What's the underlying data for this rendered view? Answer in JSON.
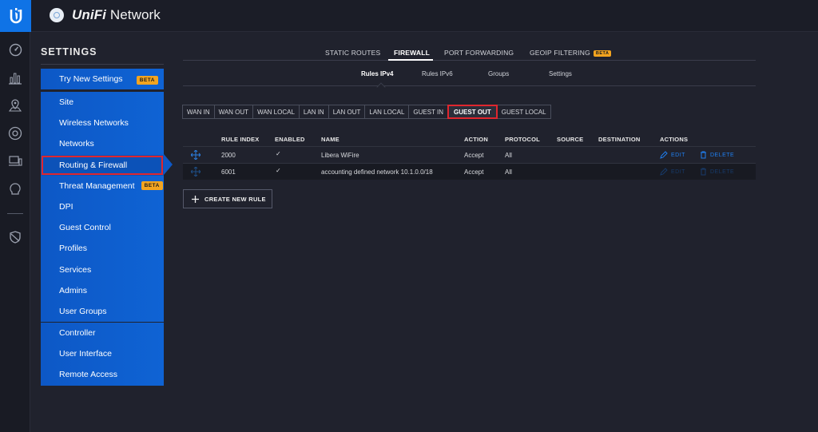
{
  "app": {
    "name_brand": "UniFi",
    "name_suffix": " Network"
  },
  "rail": {
    "icons": [
      "dashboard-icon",
      "statistics-icon",
      "map-icon",
      "devices-icon",
      "clients-icon",
      "insights-icon",
      "shield-icon"
    ]
  },
  "sidebar": {
    "title": "SETTINGS",
    "try_new": {
      "label": "Try New Settings",
      "badge": "BETA"
    },
    "items": [
      {
        "label": "Site"
      },
      {
        "label": "Wireless Networks"
      },
      {
        "label": "Networks"
      },
      {
        "label": "Routing & Firewall"
      },
      {
        "label": "Threat Management",
        "badge": "BETA"
      },
      {
        "label": "DPI"
      },
      {
        "label": "Guest Control"
      },
      {
        "label": "Profiles"
      },
      {
        "label": "Services"
      },
      {
        "label": "Admins"
      },
      {
        "label": "User Groups"
      }
    ],
    "bottom_items": [
      {
        "label": "Controller"
      },
      {
        "label": "User Interface"
      },
      {
        "label": "Remote Access"
      }
    ]
  },
  "tabs": [
    {
      "label": "STATIC ROUTES"
    },
    {
      "label": "FIREWALL"
    },
    {
      "label": "PORT FORWARDING"
    },
    {
      "label": "GEOIP FILTERING",
      "badge": "BETA"
    }
  ],
  "subtabs": [
    {
      "label": "Rules IPv4"
    },
    {
      "label": "Rules IPv6"
    },
    {
      "label": "Groups"
    },
    {
      "label": "Settings"
    }
  ],
  "chains": [
    "WAN IN",
    "WAN OUT",
    "WAN LOCAL",
    "LAN IN",
    "LAN OUT",
    "LAN LOCAL",
    "GUEST IN",
    "GUEST OUT",
    "GUEST LOCAL"
  ],
  "table": {
    "headers": {
      "rule_index": "RULE INDEX",
      "enabled": "ENABLED",
      "name": "NAME",
      "action": "ACTION",
      "protocol": "PROTOCOL",
      "source": "SOURCE",
      "destination": "DESTINATION",
      "actions": "ACTIONS"
    },
    "rows": [
      {
        "index": "2000",
        "enabled": "✓",
        "name": "Libera WiFire",
        "action": "Accept",
        "protocol": "All",
        "edit": "EDIT",
        "delete": "DELETE"
      },
      {
        "index": "6001",
        "enabled": "✓",
        "name": "accounting defined network 10.1.0.0/18",
        "action": "Accept",
        "protocol": "All",
        "edit": "EDIT",
        "delete": "DELETE"
      }
    ]
  },
  "create_button": {
    "label": "CREATE NEW RULE"
  },
  "colors": {
    "accent": "#0f73e6",
    "sidebar": "#0d58c6",
    "highlight": "#e0262e",
    "badge": "#f3a41f",
    "background": "#20222d"
  }
}
